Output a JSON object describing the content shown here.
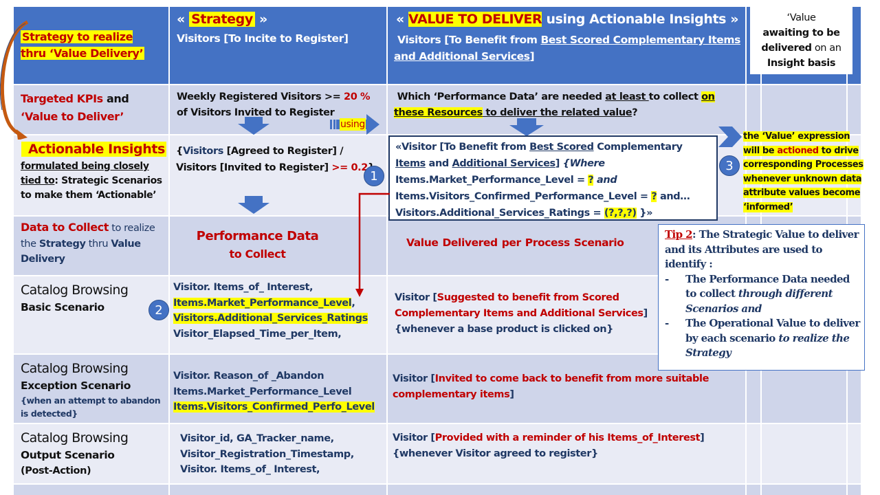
{
  "header": {
    "left_label": "Strategy to realize thru ‘Value Delivery’",
    "strategy_open": "«",
    "strategy_word": "Strategy",
    "strategy_close": "»",
    "strategy_subtitle": "Visitors [To Incite to Register]",
    "value_open": "«",
    "value_word": "VALUE TO DELIVER",
    "value_rest": " using Actionable Insights »",
    "value_subtitle_prefix": "Visitors [To Benefit from ",
    "value_subtitle_underlined": "Best Scored Complementary Items and Additional Services",
    "value_subtitle_suffix": "]",
    "awaiting_line1": "‘Value",
    "awaiting_bold1": "awaiting to be delivered",
    "awaiting_plain": " on an",
    "awaiting_bold2": "Insight basis"
  },
  "kpi_row": {
    "label_red": "Targeted KPIs",
    "label_and": " and",
    "label_value": "‘Value to Deliver’",
    "kpi_prefix": "Weekly Registered Visitors >= ",
    "kpi_pct": "20 %",
    "kpi_suffix": " of Visitors Invited to Register",
    "using_label": "using",
    "question_prefix": "Which ‘Performance Data’ are needed ",
    "question_atleast": "at least ",
    "question_mid": "to collect ",
    "question_resources": "on these Resources",
    "question_end": " to deliver the related value",
    "question_mark": "?"
  },
  "insights_row": {
    "title": "Actionable Insights",
    "desc_underlined": "formulated being closely tied to",
    "desc_rest": ": Strategic Scenarios to make them ‘Actionable’",
    "formula_visitors": "Visitors",
    "formula_part1": " [Agreed to Register] / Visitors [Invited to Register] ",
    "formula_threshold": ">= 0.2",
    "formula_close": "}",
    "formula_open": "{",
    "expr_line1_a": "«Visitor [To Benefit from ",
    "expr_line1_b": "Best Scored",
    "expr_line1_c": " Complementary ",
    "expr_line2_a": "Items",
    "expr_line2_b": " and ",
    "expr_line2_c": "Additional Services",
    "expr_line2_d": "] ",
    "expr_line2_e": "{Where",
    "expr_line3_a": "Items.Market_Performance_Level = ",
    "expr_q": "?",
    "expr_line3_and": " and",
    "expr_line4_a": "Items.Visitors_Confirmed_Performance_Level  = ",
    "expr_line4_b": " and…",
    "expr_line5_a": "Visitors.Additional_Services_Ratings  = ",
    "expr_line5_b": "(?,?,?)",
    "expr_line5_c": " }»",
    "actioned_pre": "the ‘Value’ expression will be ",
    "actioned_word": "actioned",
    "actioned_post": " to drive corresponding Processes whenever unknown data attribute values become ‘informed’"
  },
  "badges": [
    "1",
    "2",
    "3"
  ],
  "collect_row": {
    "label_red": "Data to Collect",
    "label_rest1": " to realize the ",
    "label_strategy": "Strategy",
    "label_thru": " thru ",
    "label_value": "Value Delivery",
    "perf_line1": "Performance Data",
    "perf_line2": "to Collect",
    "value_delivered": "Value Delivered per Process Scenario"
  },
  "tip": {
    "label": "Tip 2",
    "intro": ": The Strategic Value to deliver and its Attributes are used to identify :",
    "bullet1_plain": "The Performance Data needed to collect ",
    "bullet1_italic": "through different Scenarios and",
    "bullet2_plain": "The Operational Value to deliver by each scenario ",
    "bullet2_italic": "to realize the Strategy",
    "dash": "-"
  },
  "scenarios": [
    {
      "name": "Catalog Browsing",
      "type": "Basic Scenario",
      "note": "",
      "data": [
        {
          "text": "Visitor. Items_of_ Interest,",
          "highlight": false
        },
        {
          "text": "Items.Market_Performance_Level",
          "highlight": true,
          "suffix": ","
        },
        {
          "text": "Visitors.Additional_Services_Ratings",
          "highlight": true,
          "suffix": ""
        },
        {
          "text": "Visitor_Elapsed_Time_per_Item,",
          "highlight": false
        }
      ],
      "value_subject": "Visitor [",
      "value_red": "Suggested to benefit from Scored Complementary Items and Additional Services",
      "value_close": "]",
      "value_condition": "{whenever a base product is clicked on}"
    },
    {
      "name": "Catalog Browsing",
      "type": "Exception Scenario",
      "note": "{when an attempt to abandon is detected}",
      "data": [
        {
          "text": "Visitor. Reason_of _Abandon",
          "highlight": false
        },
        {
          "text": "Items.Market_Performance_Level",
          "highlight": false
        },
        {
          "text": "Items.Visitors_Confirmed_Perfo_Level",
          "highlight": true
        }
      ],
      "value_subject": "Visitor [",
      "value_red": "Invited to come back to benefit from more suitable complementary items",
      "value_close": "]",
      "value_condition": ""
    },
    {
      "name": "Catalog Browsing",
      "type": "Output Scenario",
      "note": "(Post-Action)",
      "data": [
        {
          "text": "Visitor_id, GA_Tracker_name,",
          "highlight": false
        },
        {
          "text": "Visitor_Registration_Timestamp,",
          "highlight": false
        },
        {
          "text": "Visitor. Items_of_ Interest,",
          "highlight": false
        }
      ],
      "value_subject": "Visitor [",
      "value_red": "Provided with a reminder of his Items_of_Interest",
      "value_close": "]",
      "value_condition": "{whenever Visitor agreed to register}"
    }
  ],
  "colors": {
    "header_blue": "#4472c4",
    "row_dark": "#cfd5ea",
    "row_light": "#e9ebf5",
    "accent_red": "#c00000",
    "navy_text": "#1f3864",
    "highlight": "#ffff00",
    "curved_arrow": "#c55a11"
  }
}
